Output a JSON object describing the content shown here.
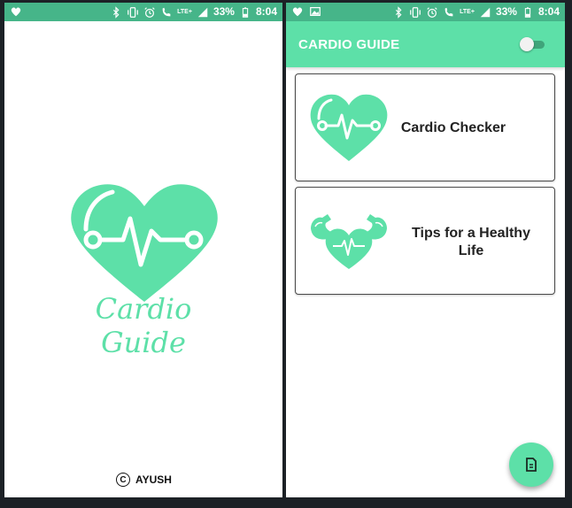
{
  "status_bar": {
    "battery": "33%",
    "time": "8:04",
    "network_label": "LTE",
    "network_label_2": "LTE+",
    "icons": [
      "heart-icon",
      "image-icon",
      "bluetooth-icon",
      "vibrate-icon",
      "alarm-icon",
      "wifi-calling-icon",
      "signal-icon",
      "battery-icon"
    ]
  },
  "splash": {
    "brand": "Cardio Guide",
    "copyright_symbol": "C",
    "author": "AYUSH"
  },
  "app_bar": {
    "title": "CARDIO GUIDE",
    "toggle_state": "off"
  },
  "cards": [
    {
      "title": "Cardio Checker",
      "icon": "heart-pulse-icon"
    },
    {
      "title_line1": "Tips for a Healthy",
      "title_line2": "Life",
      "icon": "flexing-heart-icon"
    }
  ],
  "fab": {
    "icon": "document-icon"
  },
  "colors": {
    "accent": "#5de0a8",
    "status_bar": "#46b589",
    "background_dark": "#1c2126"
  }
}
